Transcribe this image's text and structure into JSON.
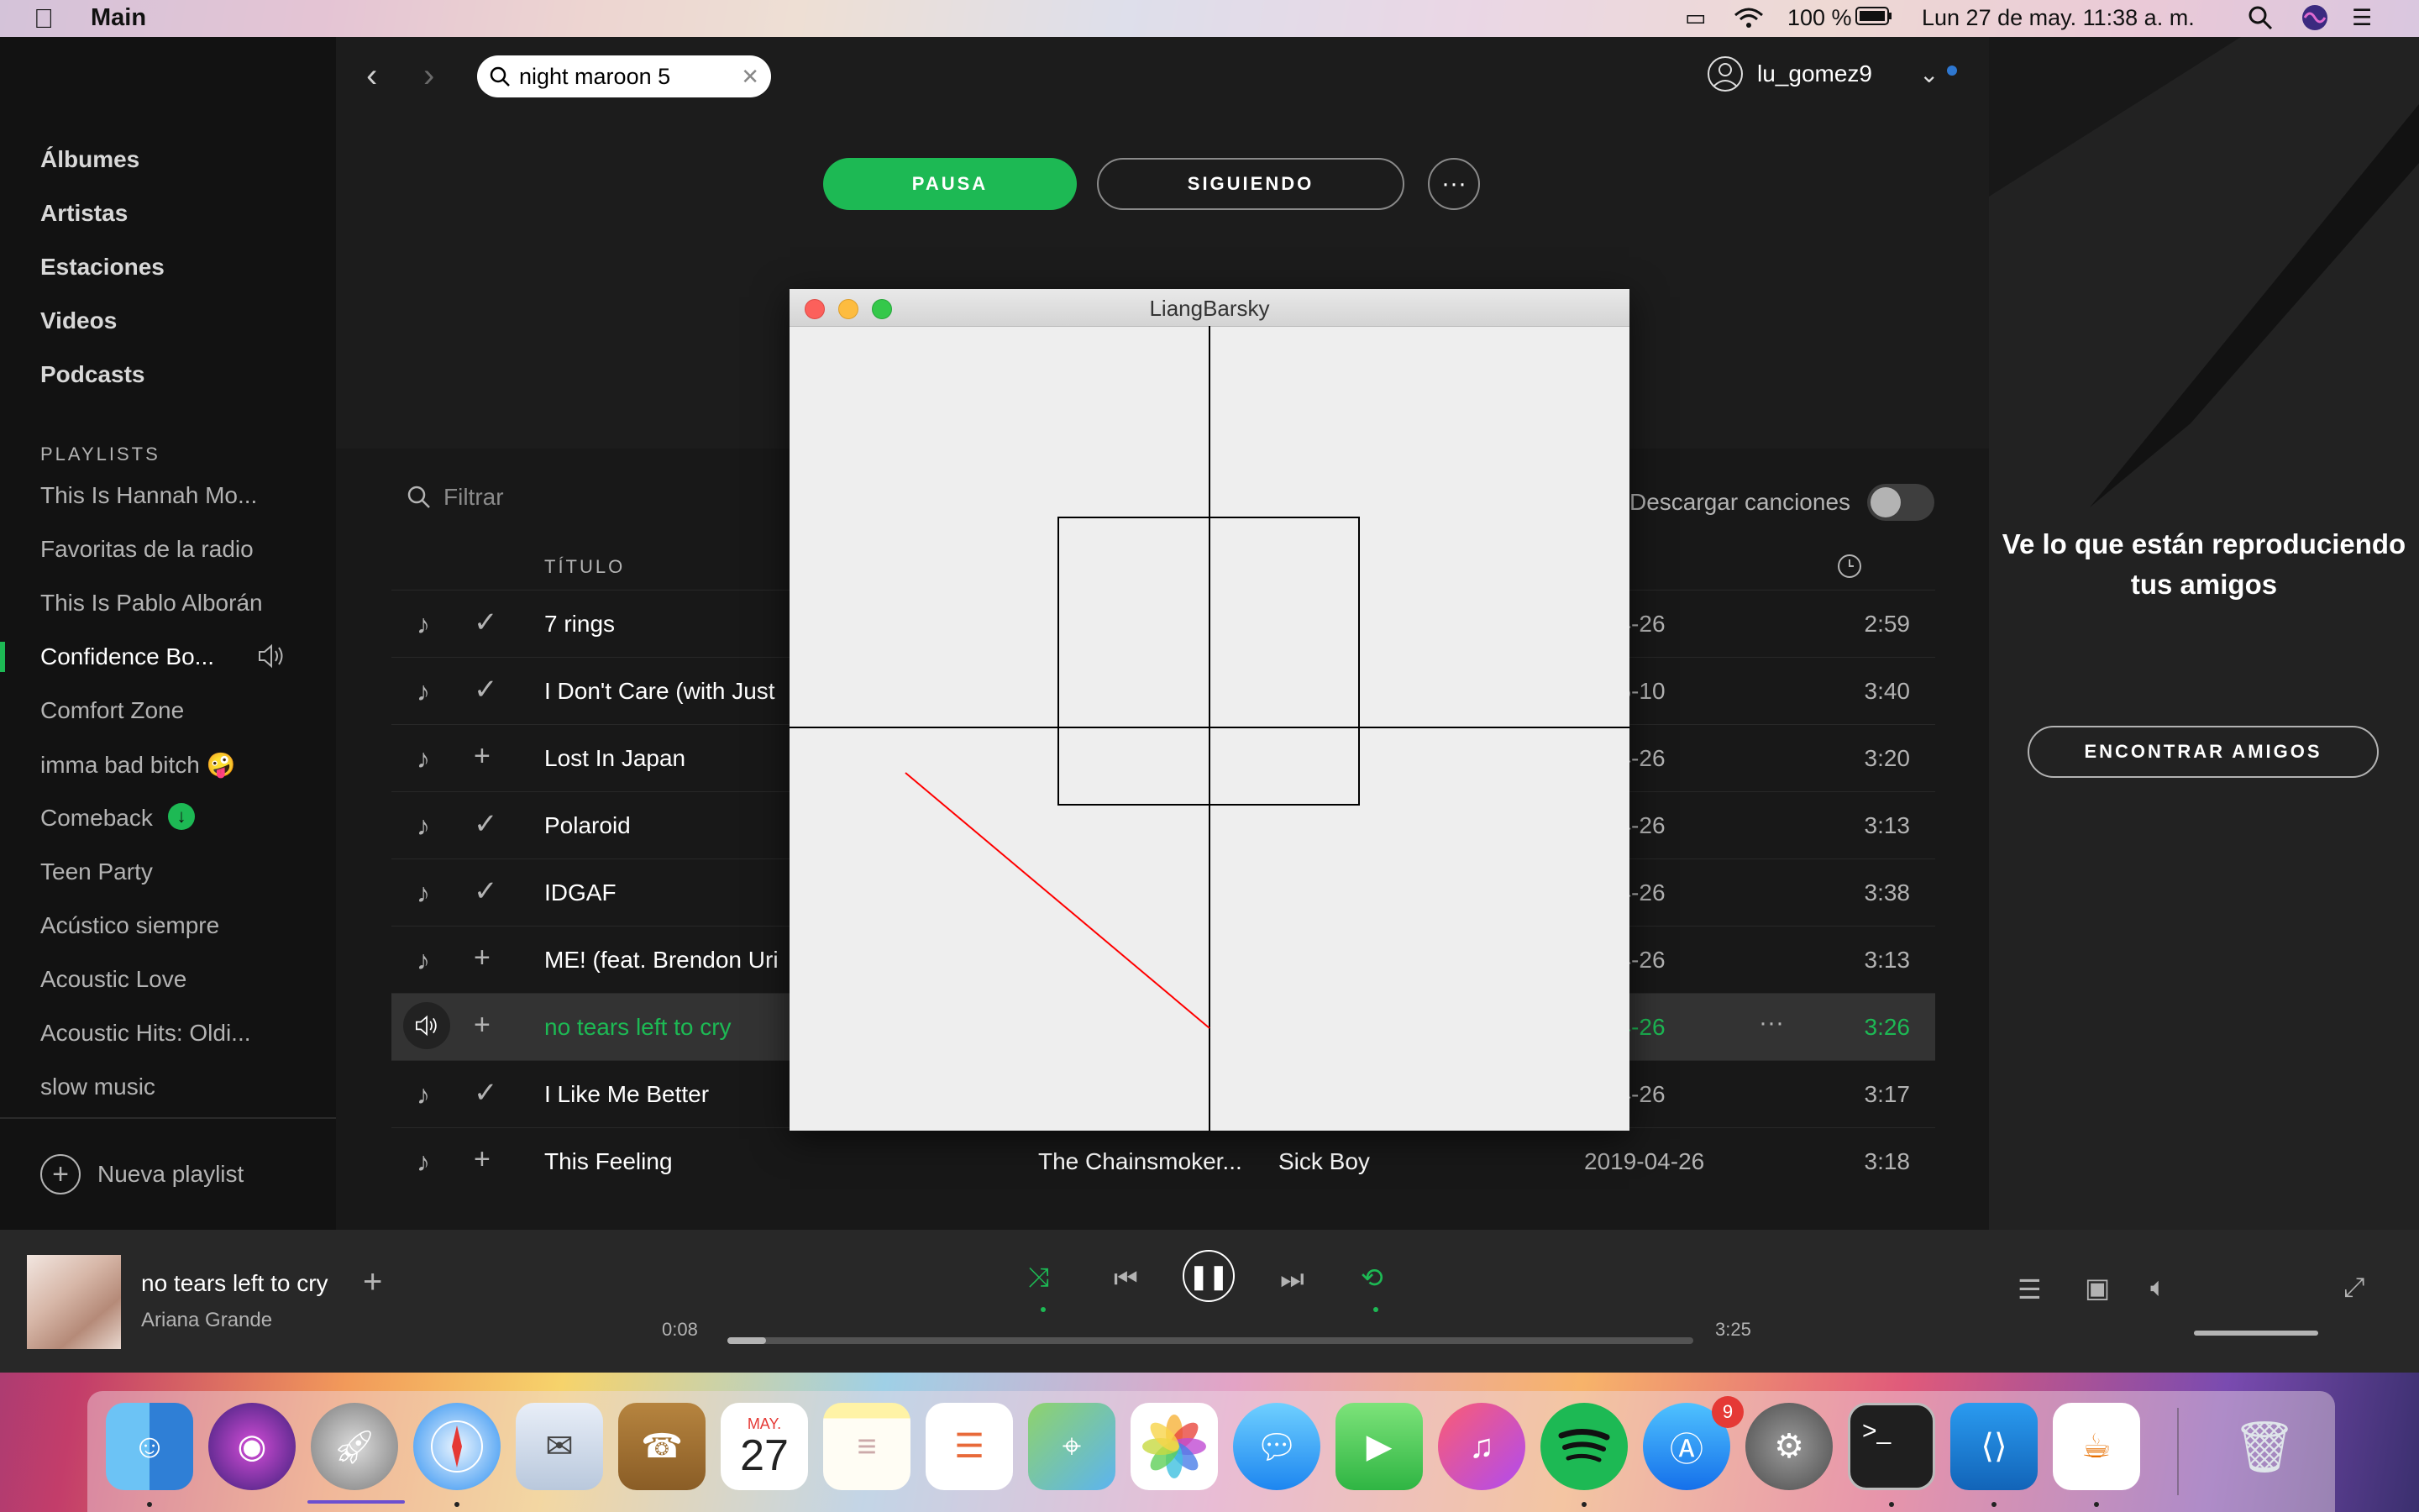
{
  "menubar": {
    "app_name": "Main",
    "battery": "100 %",
    "datetime": "Lun 27 de may.  11:38 a. m."
  },
  "spotify": {
    "search_value": "night maroon 5",
    "username": "lu_gomez9",
    "nav": [
      "Álbumes",
      "Artistas",
      "Estaciones",
      "Videos",
      "Podcasts"
    ],
    "playlists_header": "PLAYLISTS",
    "playlists": [
      "This Is Hannah Mo...",
      "Favoritas de la radio",
      "This Is Pablo Alborán",
      "Confidence Bo...",
      "Comfort Zone",
      "imma bad bitch 🤪",
      "Comeback",
      "Teen Party",
      "Acústico siempre",
      "Acoustic Love",
      "Acoustic Hits: Oldi...",
      "slow music"
    ],
    "new_playlist": "Nueva playlist",
    "pause_button": "PAUSA",
    "follow_button": "SIGUIENDO",
    "filter_placeholder": "Filtrar",
    "download_label": "Descargar canciones",
    "col_title": "TÍTULO",
    "tracks": [
      {
        "title": "7 rings",
        "artist": "",
        "album": "",
        "date": "9-04-26",
        "duration": "2:59",
        "saved": true
      },
      {
        "title": "I Don't Care (with Just",
        "artist": "",
        "album": "",
        "date": "9-05-10",
        "duration": "3:40",
        "saved": true
      },
      {
        "title": "Lost In Japan",
        "artist": "",
        "album": "",
        "date": "9-04-26",
        "duration": "3:20",
        "saved": false
      },
      {
        "title": "Polaroid",
        "artist": "",
        "album": "",
        "date": "9-04-26",
        "duration": "3:13",
        "saved": true
      },
      {
        "title": "IDGAF",
        "artist": "",
        "album": "",
        "date": "9-04-26",
        "duration": "3:38",
        "saved": true
      },
      {
        "title": "ME! (feat. Brendon Uri",
        "artist": "",
        "album": "",
        "date": "9-04-26",
        "duration": "3:13",
        "saved": false
      },
      {
        "title": "no tears left to cry",
        "artist": "",
        "album": "",
        "date": "9-04-26",
        "duration": "3:26",
        "saved": false,
        "playing": true
      },
      {
        "title": "I Like Me Better",
        "artist": "",
        "album": "",
        "date": "9-04-26",
        "duration": "3:17",
        "saved": true
      },
      {
        "title": "This Feeling",
        "artist": "The Chainsmoker...",
        "album": "Sick Boy",
        "date": "2019-04-26",
        "duration": "3:18",
        "saved": false
      }
    ],
    "friends_title": "Ve lo que están reproduciendo tus amigos",
    "find_friends": "ENCONTRAR AMIGOS",
    "now_playing": {
      "title": "no tears left to cry",
      "artist": "Ariana Grande",
      "elapsed": "0:08",
      "total": "3:25",
      "progress": 0.04,
      "volume": 1.0
    }
  },
  "liangbarsky": {
    "title": "LiangBarsky"
  },
  "dock": {
    "calendar_month": "MAY.",
    "calendar_day": "27",
    "appstore_badge": "9"
  },
  "colors": {
    "spotify_green": "#1db954",
    "clip_line": "#ff0000"
  }
}
